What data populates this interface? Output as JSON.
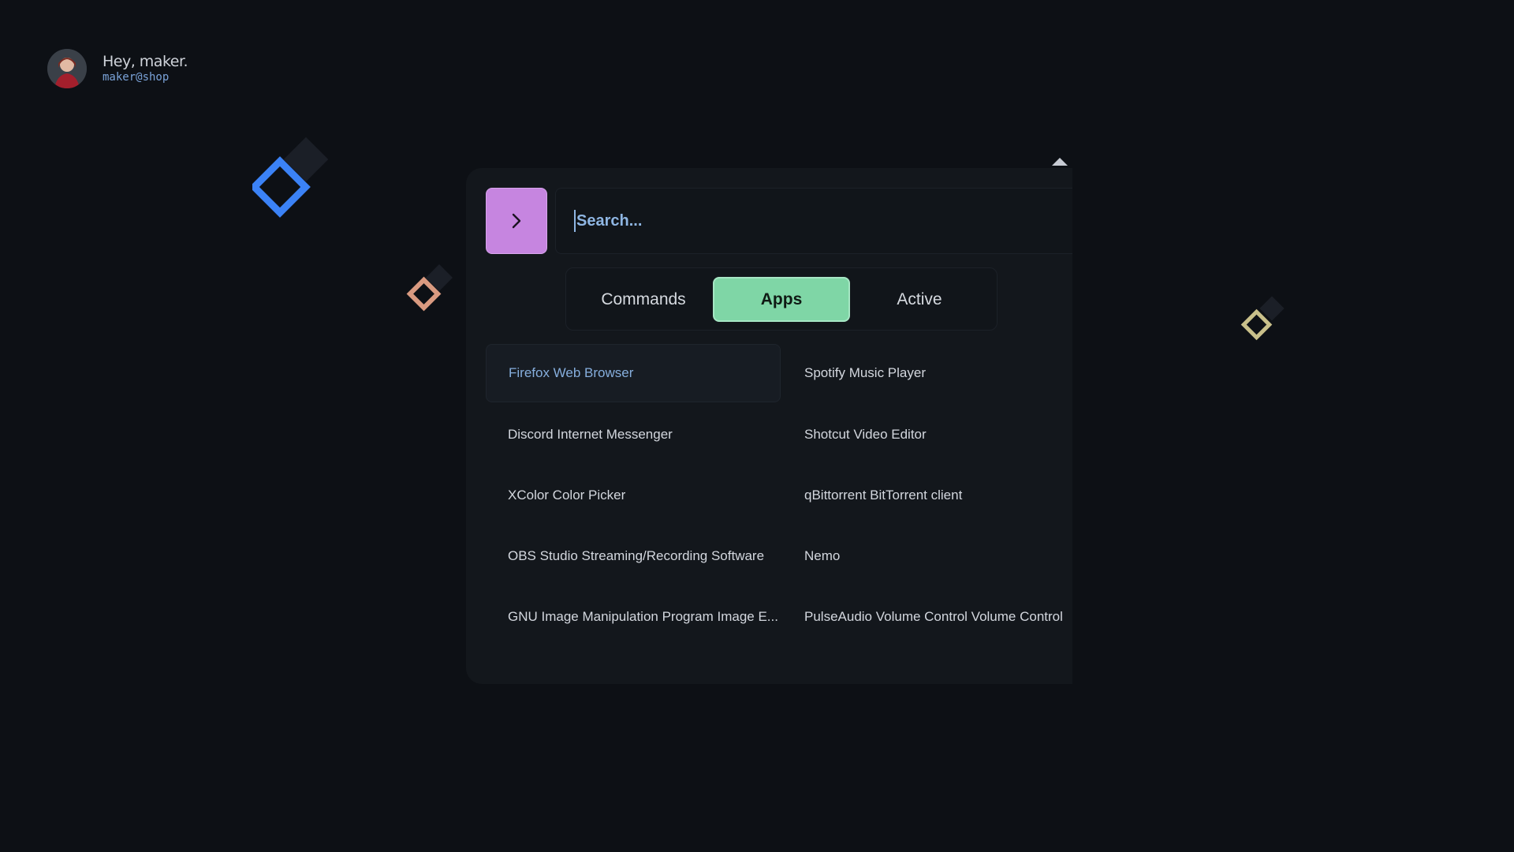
{
  "user": {
    "greeting": "Hey, maker.",
    "handle": "maker@shop",
    "avatar_icon": "user-avatar"
  },
  "launcher": {
    "prompt_icon": "chevron-right-icon",
    "search": {
      "placeholder": "Search...",
      "value": ""
    },
    "tabs": [
      {
        "label": "Commands",
        "active": false
      },
      {
        "label": "Apps",
        "active": true
      },
      {
        "label": "Active",
        "active": false
      }
    ],
    "apps": [
      {
        "label": "Firefox Web Browser",
        "selected": true
      },
      {
        "label": "Spotify Music Player",
        "selected": false
      },
      {
        "label": "Discord Internet Messenger",
        "selected": false
      },
      {
        "label": "Shotcut Video Editor",
        "selected": false
      },
      {
        "label": "XColor Color Picker",
        "selected": false
      },
      {
        "label": "qBittorrent BitTorrent client",
        "selected": false
      },
      {
        "label": "OBS Studio Streaming/Recording Software",
        "selected": false
      },
      {
        "label": "Nemo",
        "selected": false
      },
      {
        "label": "GNU Image Manipulation Program Image E...",
        "selected": false
      },
      {
        "label": "PulseAudio Volume Control Volume Control",
        "selected": false
      }
    ]
  },
  "colors": {
    "background": "#0d1015",
    "panel": "#13171c",
    "accent_purple": "#c685e0",
    "accent_green": "#7fd6a6",
    "accent_blue": "#86aedd",
    "diamond_blue": "#3b82f6",
    "diamond_salmon": "#d99a80",
    "diamond_khaki": "#c9c08a"
  }
}
